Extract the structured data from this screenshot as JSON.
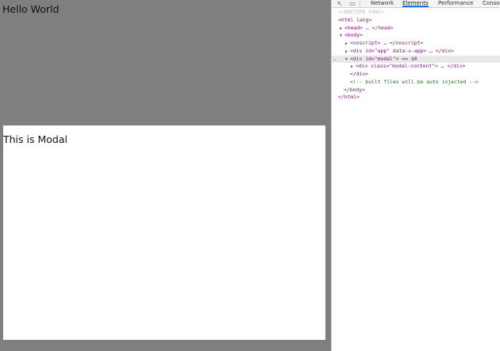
{
  "page": {
    "hello_text": "Hello World",
    "modal_text": "This is Modal"
  },
  "devtools": {
    "tabs": [
      "Network",
      "Elements",
      "Performance",
      "Consol"
    ],
    "active_tab": "Elements",
    "dom_lines": [
      "<!DOCTYPE html>",
      "<html lang>",
      "<head> … </head>",
      "<body>",
      "<noscript> … </noscript>",
      "<div id=\"app\" data-v-app> … </div>",
      "<div id=\"modal\"> == $0",
      "<div class=\"modal-content\"> … </div>",
      "</div>",
      "<!-- built files will be auto injected -->",
      "</body>",
      "</html>"
    ],
    "selected_marker": "== $0",
    "row_dots": "…"
  },
  "colors": {
    "overlay": "#7f7f7f",
    "modal_bg": "#ffffff",
    "tab_accent": "#1a73e8",
    "tag_color": "#881280",
    "attr_color": "#994500",
    "value_color": "#1a1aa6",
    "comment_color": "#236e25"
  }
}
